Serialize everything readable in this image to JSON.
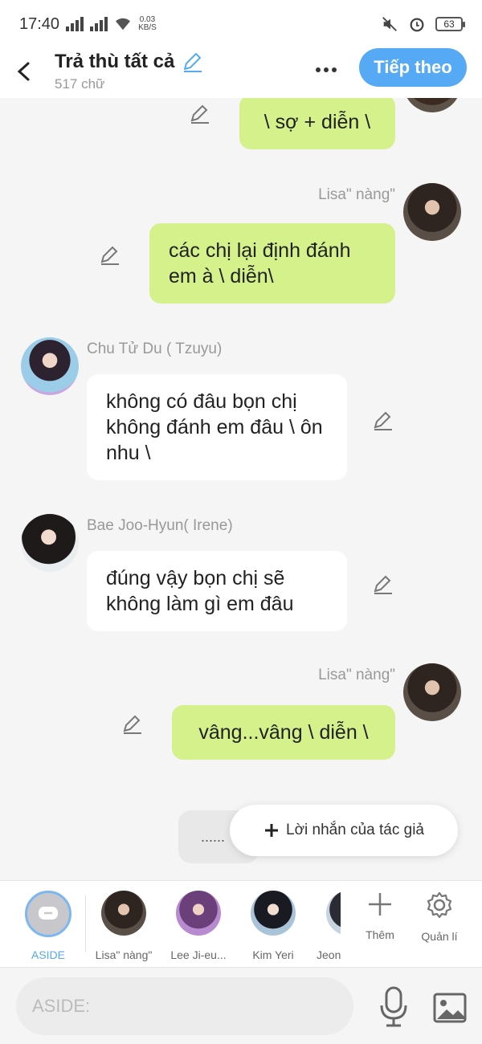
{
  "status_bar": {
    "time": "17:40",
    "net_speed_value": "0.03",
    "net_speed_unit": "KB/S",
    "battery": "63"
  },
  "header": {
    "title": "Trả thù tất cả",
    "word_count": "517 chữ",
    "next_label": "Tiếp theo"
  },
  "messages": [
    {
      "side": "right",
      "text": "\\ sợ + diễn \\",
      "color": "green"
    },
    {
      "side": "right",
      "speaker": "Lisa\" nàng\"",
      "text": "các chị lại định đánh em à \\ diễn\\",
      "color": "green"
    },
    {
      "side": "left",
      "speaker": "Chu Tử Du ( Tzuyu)",
      "text": "không có đâu bọn chị không đánh em đâu \\ ôn nhu \\",
      "color": "white"
    },
    {
      "side": "left",
      "speaker": "Bae Joo-Hyun( Irene)",
      "text": "đúng vậy bọn chị sẽ không làm gì em đâu",
      "color": "white"
    },
    {
      "side": "right",
      "speaker": "Lisa\" nàng\"",
      "text": "vâng...vâng \\ diễn \\",
      "color": "green"
    }
  ],
  "aside_bubble": "......",
  "author_note_button": "Lời nhắn của tác giả",
  "characters": [
    {
      "label": "ASIDE"
    },
    {
      "label": "Lisa\" nàng\""
    },
    {
      "label": "Lee Ji-eu..."
    },
    {
      "label": "Kim Yeri"
    },
    {
      "label": "Jeon"
    }
  ],
  "tools": {
    "add_label": "Thêm",
    "manage_label": "Quản lí"
  },
  "input": {
    "placeholder": "ASIDE:"
  },
  "colors": {
    "accent": "#56aaf5",
    "bubble_green": "#d4f18c",
    "aside_selected": "#56aaf5"
  }
}
